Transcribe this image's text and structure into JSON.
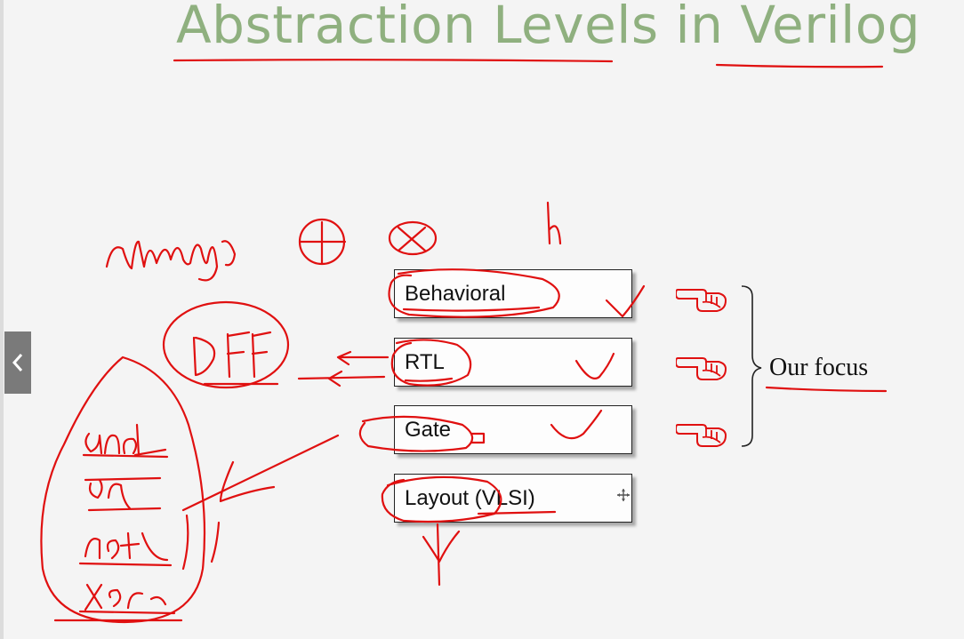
{
  "slide": {
    "title": "Abstraction Levels in Verilog",
    "levels": [
      {
        "label": "Behavioral"
      },
      {
        "label": "RTL"
      },
      {
        "label": "Gate"
      },
      {
        "label": "Layout (VLSI)"
      }
    ],
    "brace_label": "Our focus"
  },
  "nav": {
    "prev_icon": "chevron-left-icon"
  },
  "colors": {
    "title": "#8fb07f",
    "ink": "#e01010",
    "nav": "#7a7a7a"
  }
}
